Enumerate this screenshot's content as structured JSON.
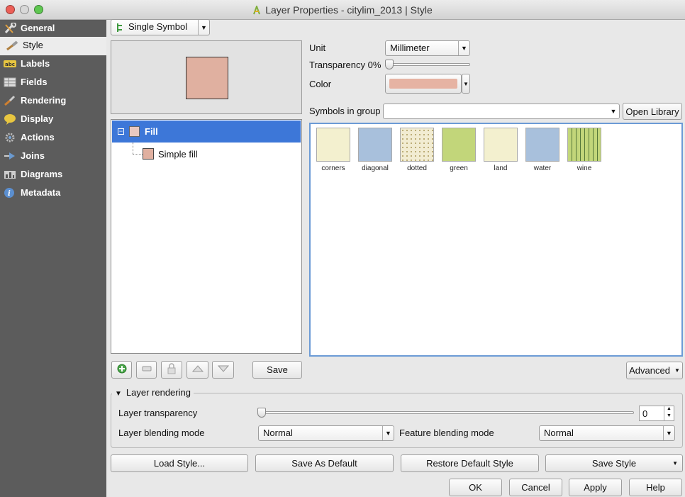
{
  "window": {
    "title": "Layer Properties - citylim_2013 | Style"
  },
  "sidebar": {
    "items": [
      {
        "label": "General",
        "icon": "wrench-icon"
      },
      {
        "label": "Style",
        "icon": "paintbrush-icon"
      },
      {
        "label": "Labels",
        "icon": "abc-label-icon"
      },
      {
        "label": "Fields",
        "icon": "table-icon"
      },
      {
        "label": "Rendering",
        "icon": "brush-icon"
      },
      {
        "label": "Display",
        "icon": "speech-bubble-icon"
      },
      {
        "label": "Actions",
        "icon": "gear-icon"
      },
      {
        "label": "Joins",
        "icon": "join-icon"
      },
      {
        "label": "Diagrams",
        "icon": "chart-icon"
      },
      {
        "label": "Metadata",
        "icon": "info-icon"
      }
    ],
    "active_index": 1
  },
  "renderer": {
    "type": "Single Symbol"
  },
  "symbol_tree": {
    "root": "Fill",
    "child": "Simple fill",
    "fill_color": "#e0b0a0"
  },
  "properties": {
    "unit_label": "Unit",
    "unit_value": "Millimeter",
    "transparency_label": "Transparency 0%",
    "color_label": "Color",
    "color_value": "#e6b3a3",
    "symbols_in_group_label": "Symbols in group",
    "group_value": "",
    "open_library": "Open Library"
  },
  "symbols": [
    {
      "name": "corners",
      "color": "#f3f0cf"
    },
    {
      "name": "diagonal",
      "color": "#a8c0dc"
    },
    {
      "name": "dotted",
      "color": "#f2ecd2"
    },
    {
      "name": "green",
      "color": "#c2d67a"
    },
    {
      "name": "land",
      "color": "#f3f0cf"
    },
    {
      "name": "water",
      "color": "#a8c0dc"
    },
    {
      "name": "wine",
      "color": "#c2d67a"
    }
  ],
  "tree_toolbar": {
    "save": "Save"
  },
  "advanced": "Advanced",
  "layer_rendering": {
    "title": "Layer rendering",
    "transparency_label": "Layer transparency",
    "transparency_value": "0",
    "blending_label": "Layer blending mode",
    "blending_value": "Normal",
    "feature_blending_label": "Feature blending mode",
    "feature_blending_value": "Normal"
  },
  "style_buttons": {
    "load": "Load Style...",
    "save_default": "Save As Default",
    "restore_default": "Restore Default Style",
    "save_style": "Save Style"
  },
  "dialog_buttons": {
    "ok": "OK",
    "cancel": "Cancel",
    "apply": "Apply",
    "help": "Help"
  }
}
